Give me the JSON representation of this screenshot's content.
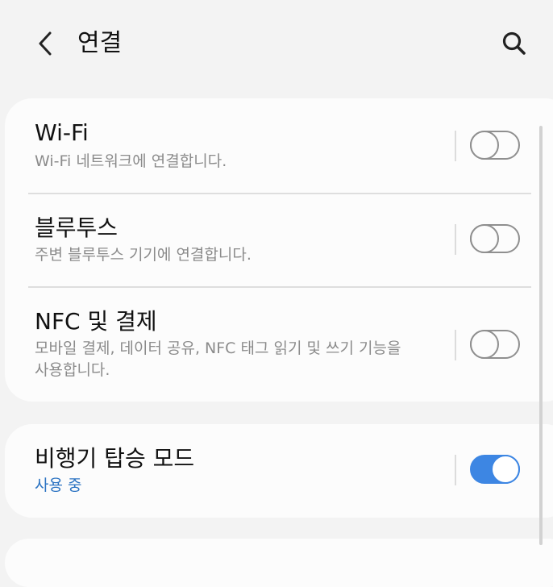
{
  "header": {
    "title": "연결",
    "back_icon": "chevron-left-icon",
    "search_icon": "search-icon"
  },
  "settings": [
    {
      "title": "Wi-Fi",
      "subtitle": "Wi-Fi 네트워크에 연결합니다.",
      "enabled": false
    },
    {
      "title": "블루투스",
      "subtitle": "주변 블루투스 기기에 연결합니다.",
      "enabled": false
    },
    {
      "title": "NFC 및 결제",
      "subtitle_line1": "모바일 결제, 데이터 공유, NFC 태그 읽기 및 쓰기 기능을",
      "subtitle_line2": "사용합니다.",
      "enabled": false
    },
    {
      "title": "비행기 탑승 모드",
      "subtitle": "사용 중",
      "enabled": true
    }
  ],
  "colors": {
    "background": "#f3f3f3",
    "card": "#fcfcfc",
    "accent": "#3d86e3",
    "active_text": "#2b73c2",
    "secondary_text": "#8b8b8b"
  }
}
